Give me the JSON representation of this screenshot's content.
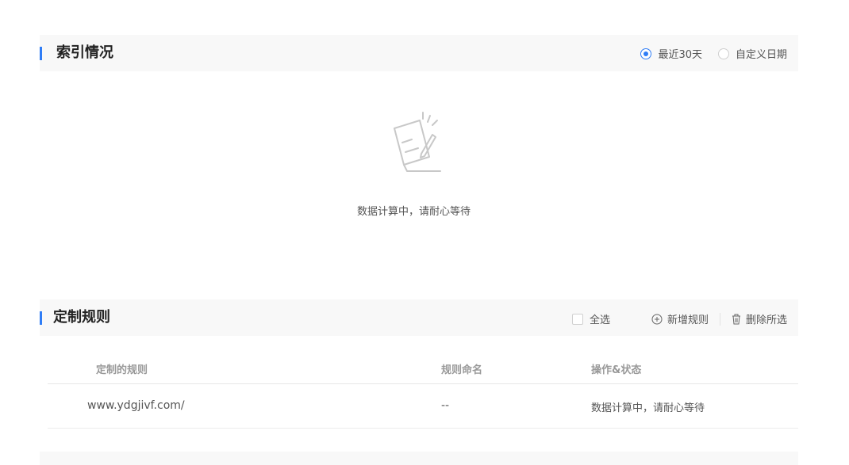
{
  "index_section": {
    "title": "索引情况",
    "radio_options": [
      {
        "label": "最近30天",
        "checked": true
      },
      {
        "label": "自定义日期",
        "checked": false
      }
    ]
  },
  "empty_state": {
    "icon": "pencil-paper-icon",
    "message": "数据计算中，请耐心等待"
  },
  "rules_section": {
    "title": "定制规则",
    "select_all_label": "全选",
    "add_rule_label": "新增规则",
    "delete_selected_label": "删除所选"
  },
  "rules_table": {
    "columns": [
      "定制的规则",
      "规则命名",
      "操作&状态"
    ],
    "rows": [
      {
        "rule": "www.ydgjivf.com/",
        "name": "--",
        "status": "数据计算中，请耐心等待"
      }
    ]
  },
  "colors": {
    "accent": "#2f7df6",
    "header_bg": "#f8f8f8"
  }
}
